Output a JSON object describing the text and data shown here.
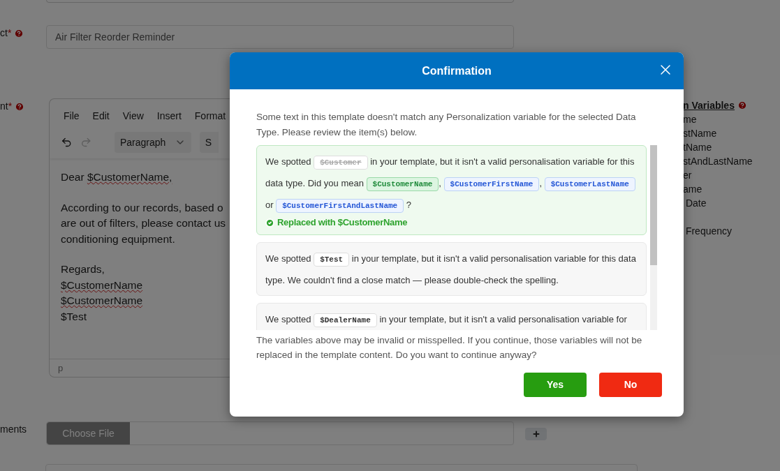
{
  "form": {
    "subject": {
      "label": "ct",
      "mark": "*",
      "value": "Air Filter Reorder Reminder"
    },
    "content": {
      "label": "nt",
      "mark": "*"
    },
    "attachments": {
      "label": "ments",
      "button": "Choose File"
    }
  },
  "editor": {
    "menu": [
      "File",
      "Edit",
      "View",
      "Insert",
      "Format"
    ],
    "undo_disabled": false,
    "redo_disabled": true,
    "block_format": "Paragraph",
    "font_select": "S",
    "paragraphs": [
      [
        [
          {
            "text": "Dear "
          },
          {
            "text": "$CustomerName,",
            "misspelled": true
          }
        ]
      ],
      [
        [
          {
            "text": "According to our records, based o"
          }
        ],
        [
          {
            "text": "are out of filters, please contact us"
          }
        ],
        [
          {
            "text": "conditioning equipment."
          }
        ]
      ],
      [
        [
          {
            "text": "Regards,"
          }
        ],
        [
          {
            "text": "$CustomerName",
            "misspelled": true
          }
        ],
        [
          {
            "text": "$CustomerName",
            "misspelled": true
          }
        ],
        [
          {
            "text": "$Test"
          }
        ]
      ]
    ],
    "status_path": "p"
  },
  "variables_panel": {
    "heading": "n Variables",
    "items": [
      "me",
      "stName",
      "tName",
      "stAndLastName",
      "er",
      "ame",
      " Date",
      " Frequency"
    ]
  },
  "dialog": {
    "title": "Confirmation",
    "intro": "Some text in this template doesn't match any Personalization variable for the selected Data Type. Please review the item(s) below.",
    "issues": [
      {
        "replaced": true,
        "parts": [
          {
            "kind": "text",
            "text": "We spotted "
          },
          {
            "kind": "variable",
            "text": "$Customer",
            "struck": true
          },
          {
            "kind": "text",
            "text": " in your template, but it isn't a valid personalisation variable for this data type. Did you mean "
          },
          {
            "kind": "suggestion",
            "text": "$CustomerName",
            "selected": true
          },
          {
            "kind": "text",
            "text": ", "
          },
          {
            "kind": "suggestion",
            "text": "$CustomerFirstName",
            "selected": false
          },
          {
            "kind": "text",
            "text": ", "
          },
          {
            "kind": "suggestion",
            "text": "$CustomerLastName",
            "selected": false
          },
          {
            "kind": "text",
            "text": " or "
          },
          {
            "kind": "suggestion",
            "text": "$CustomerFirstAndLastName",
            "selected": false
          },
          {
            "kind": "text",
            "text": " ?"
          }
        ],
        "note": "Replaced with $CustomerName"
      },
      {
        "replaced": false,
        "parts": [
          {
            "kind": "text",
            "text": "We spotted "
          },
          {
            "kind": "variable",
            "text": "$Test",
            "struck": false
          },
          {
            "kind": "text",
            "text": " in your template, but it isn't a valid personalisation variable for this data type. We couldn't find a close match — please double-check the spelling."
          }
        ]
      },
      {
        "replaced": false,
        "parts": [
          {
            "kind": "text",
            "text": "We spotted "
          },
          {
            "kind": "variable",
            "text": "$DealerName",
            "struck": false
          },
          {
            "kind": "text",
            "text": " in your template, but it isn't a valid personalisation variable for"
          }
        ]
      }
    ],
    "warning": "The variables above may be invalid or misspelled. If you continue, those variables will not be replaced in the template content. Do you want to continue anyway?",
    "buttons": [
      {
        "kind": "confirm",
        "label": "Yes"
      },
      {
        "kind": "cancel",
        "label": "No"
      }
    ]
  }
}
